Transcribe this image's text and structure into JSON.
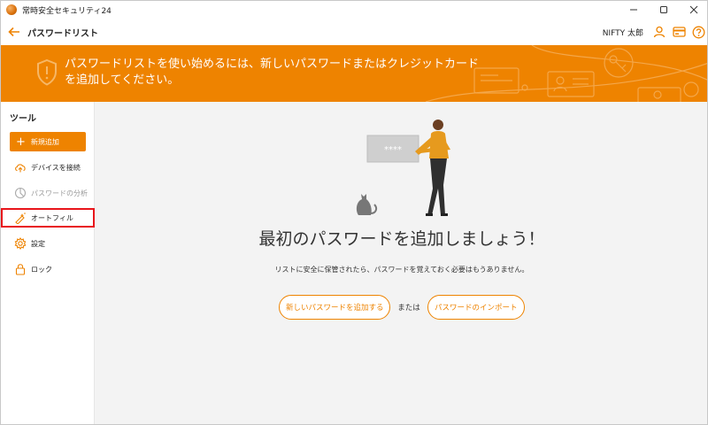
{
  "window": {
    "title": "常時安全セキュリティ24"
  },
  "header": {
    "title": "パスワードリスト",
    "user": "NIFTY 太郎"
  },
  "banner": {
    "message": "パスワードリストを使い始めるには、新しいパスワードまたはクレジットカードを追加してください。"
  },
  "sidebar": {
    "title": "ツール",
    "new_label": "新規追加",
    "items": [
      {
        "label": "デバイスを接続",
        "icon": "cloud-upload-icon"
      },
      {
        "label": "パスワードの分析",
        "icon": "analysis-icon"
      },
      {
        "label": "オートフィル",
        "icon": "autofill-icon"
      },
      {
        "label": "設定",
        "icon": "gear-icon"
      },
      {
        "label": "ロック",
        "icon": "lock-icon"
      }
    ]
  },
  "main": {
    "illustration_card_text": "****",
    "title": "最初のパスワードを追加しましょう！",
    "description": "リストに安全に保管されたら、パスワードを覚えておく必要はもうありません。",
    "add_button": "新しいパスワードを追加する",
    "or": "または",
    "import_button": "パスワードのインポート"
  },
  "colors": {
    "accent": "#ee8300",
    "highlight": "#e8151b"
  }
}
